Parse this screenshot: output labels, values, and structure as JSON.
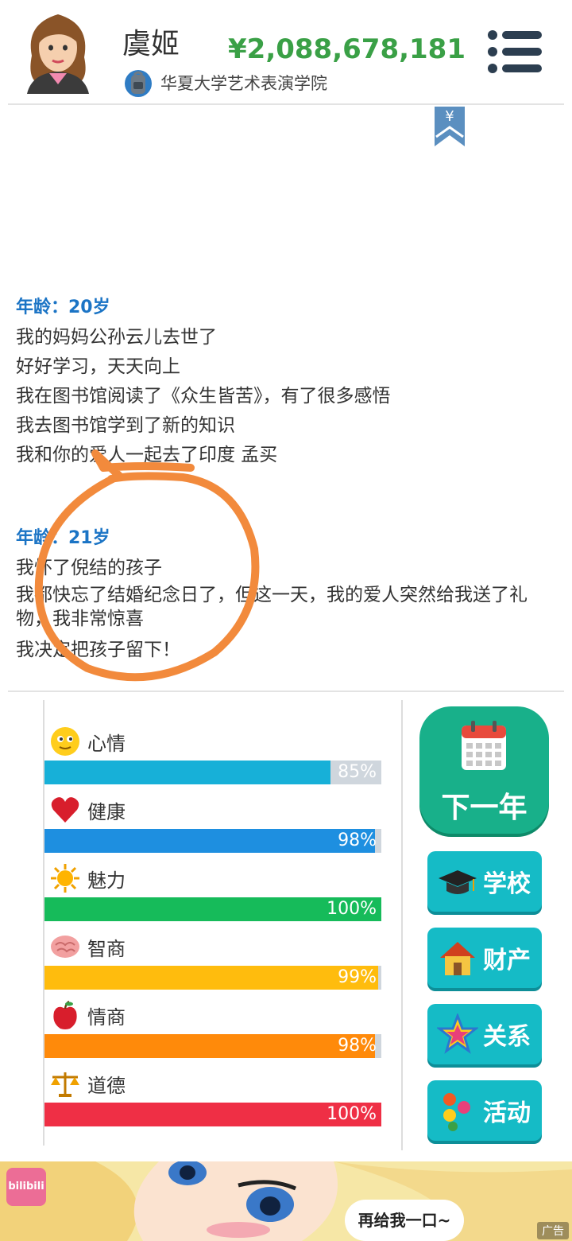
{
  "header": {
    "name": "虞姬",
    "school": "华夏大学艺术表演学院",
    "money": "¥2,088,678,181",
    "bookmark_symbol": "¥"
  },
  "log": [
    {
      "age_title": "年龄：20岁",
      "lines": [
        "我的妈妈公孙云儿去世了",
        "好好学习，天天向上",
        "我在图书馆阅读了《众生皆苦》，有了很多感悟",
        "我去图书馆学到了新的知识",
        "我和你的爱人一起去了印度 孟买"
      ]
    },
    {
      "age_title": "年龄：21岁",
      "lines": [
        "我怀了倪结的孩子",
        "我都快忘了结婚纪念日了，但这一天，我的爱人突然给我送了礼物，我非常惊喜",
        "我决定把孩子留下！"
      ]
    }
  ],
  "stats": [
    {
      "label": "心情",
      "percent_text": "85%",
      "value": 85,
      "color": "#17b0d8",
      "icon": "smiley-icon"
    },
    {
      "label": "健康",
      "percent_text": "98%",
      "value": 98,
      "color": "#1e8fe0",
      "icon": "heart-icon"
    },
    {
      "label": "魅力",
      "percent_text": "100%",
      "value": 100,
      "color": "#16bb5a",
      "icon": "sun-icon"
    },
    {
      "label": "智商",
      "percent_text": "99%",
      "value": 99,
      "color": "#ffbc0d",
      "icon": "brain-icon"
    },
    {
      "label": "情商",
      "percent_text": "98%",
      "value": 98,
      "color": "#ff8a0a",
      "icon": "apple-icon"
    },
    {
      "label": "道德",
      "percent_text": "100%",
      "value": 100,
      "color": "#ef2f45",
      "icon": "scales-icon"
    }
  ],
  "actions": {
    "next_year": "下一年",
    "buttons": [
      {
        "label": "学校",
        "icon": "graduation-cap-icon"
      },
      {
        "label": "财产",
        "icon": "house-icon"
      },
      {
        "label": "关系",
        "icon": "star-icon"
      },
      {
        "label": "活动",
        "icon": "dots-icon"
      }
    ]
  },
  "ad": {
    "logo_text": "bilibili",
    "bubble_text": "再给我一口~",
    "tag": "广告"
  },
  "colors": {
    "money": "#3aa046",
    "age_title": "#1b74c5",
    "next_year_bg": "#18b08a",
    "side_button_bg": "#15bbc6",
    "annotation": "#f28a3c"
  }
}
